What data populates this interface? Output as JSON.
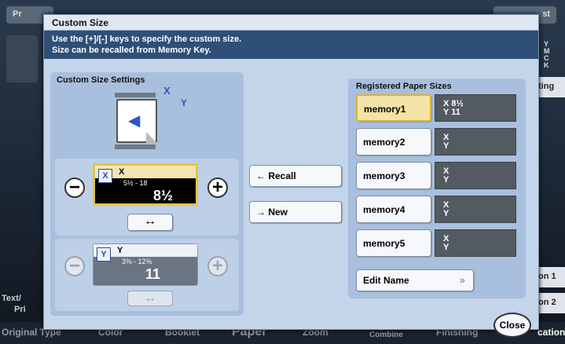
{
  "background": {
    "top_left_tab": "Pr",
    "top_right_tab": "st",
    "left_items": [
      "Text/",
      "Pri"
    ],
    "right_buttons": [
      "ting",
      "on 1",
      "on 2"
    ],
    "toner_letters": [
      "Y",
      "M",
      "C",
      "K"
    ],
    "bottom_tabs": [
      "Original Type",
      "Color",
      "Booklet",
      "Paper",
      "Zoom",
      "Duplex/ Combine",
      "Finishing",
      "cation"
    ]
  },
  "dialog": {
    "title": "Custom Size",
    "message_line1": "Use the [+]/[-] keys to specify the custom size.",
    "message_line2": "Size can be recalled from Memory Key.",
    "settings": {
      "title": "Custom Size Settings",
      "axis_x": "X",
      "axis_y": "Y",
      "x_field": {
        "axis": "X",
        "range": "5½ - 18",
        "value": "8½"
      },
      "y_field": {
        "axis": "Y",
        "range": "3⅝ - 12⅝",
        "value": "11"
      },
      "swap_label": "↔"
    },
    "actions": {
      "recall": "← Recall",
      "new": "→ New"
    },
    "registered": {
      "title": "Registered Paper Sizes",
      "memories": [
        {
          "name": "memory1",
          "x": "X  8½",
          "y": "Y 11",
          "selected": true
        },
        {
          "name": "memory2",
          "x": "X",
          "y": "Y",
          "selected": false
        },
        {
          "name": "memory3",
          "x": "X",
          "y": "Y",
          "selected": false
        },
        {
          "name": "memory4",
          "x": "X",
          "y": "Y",
          "selected": false
        },
        {
          "name": "memory5",
          "x": "X",
          "y": "Y",
          "selected": false
        }
      ],
      "edit_name": "Edit Name",
      "edit_icon": "double-chevron-right-icon"
    },
    "close_label": "Close"
  },
  "colors": {
    "dialog_bg": "#c4d5ea",
    "message_bg": "#2f4f78",
    "selected_memory": "#f3e3a6",
    "value_box": "#545a61",
    "accent_yellow": "#e8c343"
  }
}
